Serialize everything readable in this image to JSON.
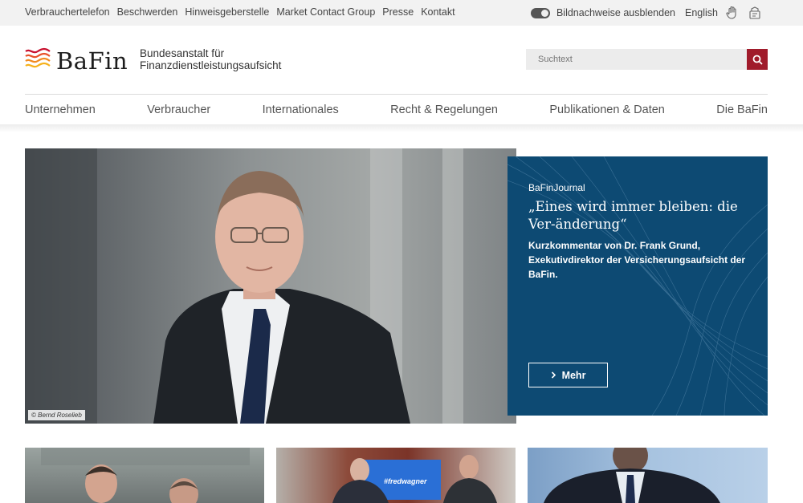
{
  "topbar": {
    "links": [
      "Verbrauchertelefon",
      "Beschwerden",
      "Hinweisgeberstelle",
      "Market Contact Group",
      "Presse",
      "Kontakt"
    ],
    "image_credits_toggle_label": "Bildnachweise ausblenden",
    "language_link": "English"
  },
  "header": {
    "logo_text": "BaFin",
    "subtitle_line1": "Bundesanstalt für",
    "subtitle_line2": "Finanzdienstleistungsaufsicht",
    "search_placeholder": "Suchtext"
  },
  "nav": {
    "items": [
      "Unternehmen",
      "Verbraucher",
      "Internationales",
      "Recht & Regelungen",
      "Publikationen & Daten",
      "Die BaFin"
    ]
  },
  "hero": {
    "photo_credit": "© Bernd Roselieb",
    "kicker": "BaFinJournal",
    "headline": "„Eines wird immer bleiben: die Ver-änderung“",
    "description": "Kurzkommentar von Dr. Frank Grund, Exekutivdirektor der Versicherungsaufsicht der BaFin.",
    "button_label": "Mehr"
  },
  "cards": {
    "card2_screen_text": "#fredwagner"
  },
  "colors": {
    "accent_red": "#a01b2b",
    "teaser_blue": "#0d4a73",
    "topbar_bg": "#f2f2f2"
  },
  "icons": {
    "toggle": "toggle-icon",
    "hand": "hand-icon",
    "sign_language": "sign-language-icon",
    "search": "search-icon",
    "chevron": "chevron-right-icon"
  }
}
